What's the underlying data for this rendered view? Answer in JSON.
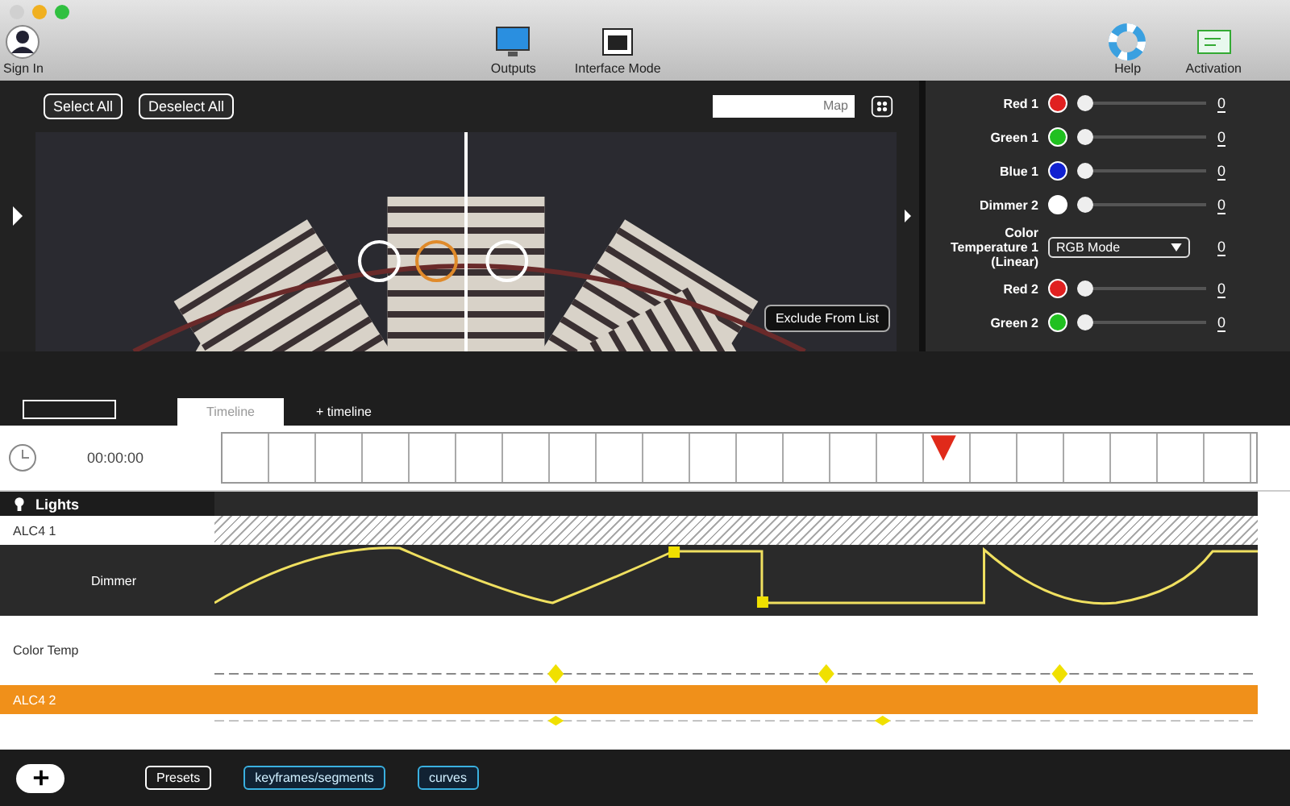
{
  "toolbar": {
    "left": [
      {
        "label": "Sign In"
      }
    ],
    "center": [
      {
        "label": "Outputs"
      },
      {
        "label": "Interface Mode"
      }
    ],
    "right": [
      {
        "label": "Help"
      },
      {
        "label": "Activation"
      }
    ]
  },
  "stage": {
    "buttons": [
      "Select All",
      "Deselect All"
    ],
    "search": {
      "placeholder": "Map"
    },
    "overlay_button": "Exclude From List"
  },
  "channels": [
    {
      "kind": "slider",
      "name": "Red 1",
      "color": "#e02020",
      "level": 0,
      "reading": "0"
    },
    {
      "kind": "slider",
      "name": "Green 1",
      "color": "#20c020",
      "level": 0,
      "reading": "0"
    },
    {
      "kind": "slider",
      "name": "Blue 1",
      "color": "#1020d0",
      "level": 0,
      "reading": "0"
    },
    {
      "kind": "slider",
      "name": "Dimmer 2",
      "color": "#ffffff",
      "level": 0,
      "reading": "0"
    },
    {
      "kind": "dropdown",
      "name": "Color Temperature 1 (Linear)",
      "value": "RGB Mode",
      "reading": "0"
    },
    {
      "kind": "slider",
      "name": "Red 2",
      "color": "#e02020",
      "level": 0,
      "reading": "0"
    },
    {
      "kind": "slider",
      "name": "Green 2",
      "color": "#20c020",
      "level": 0,
      "reading": "0"
    }
  ],
  "tabs": [
    {
      "label": "Timeline",
      "selected": true
    },
    {
      "label": "+ timeline",
      "selected": false
    }
  ],
  "timeline": {
    "time": "00:00:00",
    "section": "Lights",
    "tracks": [
      {
        "kind": "hatched",
        "name": "ALC4 1"
      },
      {
        "kind": "curve",
        "name": "Dimmer"
      },
      {
        "kind": "diamonds",
        "name": "Color Temp"
      },
      {
        "kind": "group",
        "name": "ALC4 2"
      },
      {
        "kind": "diamonds2"
      }
    ]
  },
  "footer": {
    "buttons": [
      "Presets",
      "keyframes/segments",
      "curves"
    ]
  }
}
